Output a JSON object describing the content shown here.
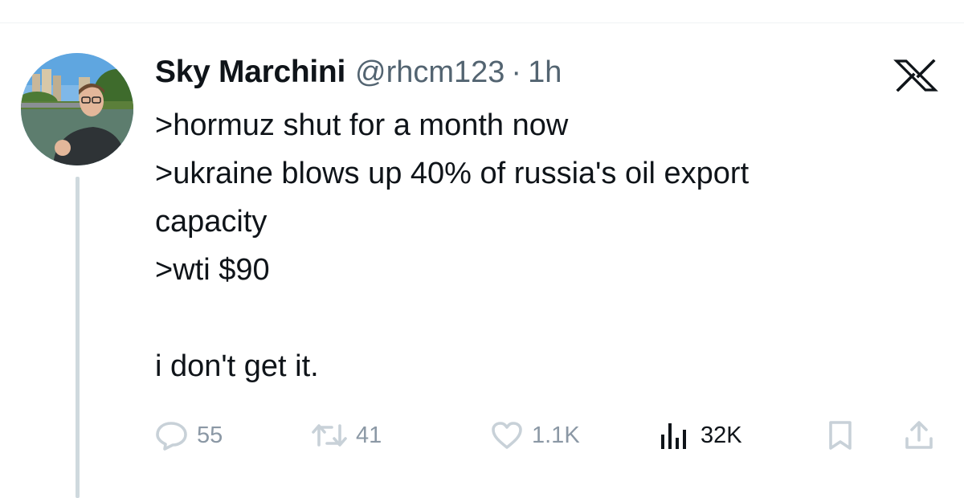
{
  "tweet": {
    "display_name": "Sky Marchini",
    "handle": "@rhcm123",
    "separator": "·",
    "time": "1h",
    "lines": [
      ">hormuz shut for a month now",
      ">ukraine blows up 40% of russia's oil export",
      "capacity",
      ">wti $90",
      "i don't get it."
    ]
  },
  "actions": {
    "replies": "55",
    "reposts": "41",
    "likes": "1.1K",
    "views": "32K"
  },
  "icons": {
    "brand": "x-logo-icon",
    "reply": "comment-icon",
    "repost": "repost-icon",
    "like": "heart-icon",
    "views": "views-chart-icon",
    "bookmark": "bookmark-icon",
    "share": "share-icon"
  },
  "colors": {
    "text": "#0f1419",
    "secondary": "#536471",
    "muted_icon": "#8b98a5",
    "thread_line": "#cfd9de"
  }
}
